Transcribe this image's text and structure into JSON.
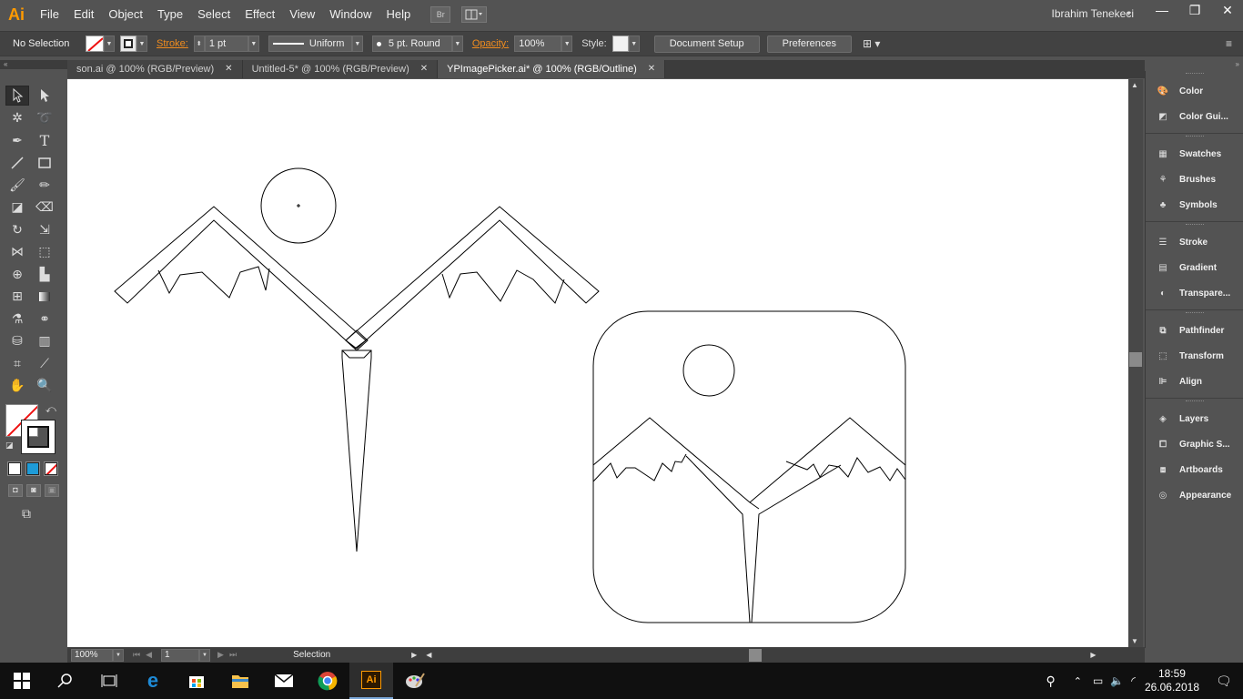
{
  "app": {
    "logo": "Ai",
    "menu": [
      "File",
      "Edit",
      "Object",
      "Type",
      "Select",
      "Effect",
      "View",
      "Window",
      "Help"
    ],
    "bridge_button": "Br",
    "user_name": "Ibrahim Tenekeci"
  },
  "control_bar": {
    "selection_label": "No Selection",
    "stroke_label": "Stroke:",
    "stroke_weight": "1 pt",
    "profile": "Uniform",
    "brush": "5 pt. Round",
    "opacity_label": "Opacity:",
    "opacity_value": "100%",
    "style_label": "Style:",
    "document_setup": "Document Setup",
    "preferences": "Preferences"
  },
  "tabs": [
    {
      "label": "son.ai @ 100% (RGB/Preview)",
      "active": false
    },
    {
      "label": "Untitled-5* @ 100% (RGB/Preview)",
      "active": false
    },
    {
      "label": "YPImagePicker.ai* @ 100% (RGB/Outline)",
      "active": true
    }
  ],
  "status_bar": {
    "zoom": "100%",
    "artboard_number": "1",
    "current_tool": "Selection"
  },
  "panels": [
    {
      "group": 1,
      "items": [
        {
          "label": "Color",
          "icon": "color-palette-icon"
        },
        {
          "label": "Color Gui...",
          "icon": "color-guide-icon"
        }
      ]
    },
    {
      "group": 2,
      "items": [
        {
          "label": "Swatches",
          "icon": "swatches-icon"
        },
        {
          "label": "Brushes",
          "icon": "brushes-icon"
        },
        {
          "label": "Symbols",
          "icon": "symbols-icon"
        }
      ]
    },
    {
      "group": 3,
      "items": [
        {
          "label": "Stroke",
          "icon": "stroke-icon"
        },
        {
          "label": "Gradient",
          "icon": "gradient-icon"
        },
        {
          "label": "Transpare...",
          "icon": "transparency-icon"
        }
      ]
    },
    {
      "group": 4,
      "items": [
        {
          "label": "Pathfinder",
          "icon": "pathfinder-icon"
        },
        {
          "label": "Transform",
          "icon": "transform-icon"
        },
        {
          "label": "Align",
          "icon": "align-icon"
        }
      ]
    },
    {
      "group": 5,
      "items": [
        {
          "label": "Layers",
          "icon": "layers-icon"
        },
        {
          "label": "Graphic S...",
          "icon": "graphic-styles-icon"
        },
        {
          "label": "Artboards",
          "icon": "artboards-icon"
        },
        {
          "label": "Appearance",
          "icon": "appearance-icon"
        }
      ]
    }
  ],
  "taskbar": {
    "time": "18:59",
    "date": "26.06.2018",
    "illustrator_label": "Ai"
  }
}
